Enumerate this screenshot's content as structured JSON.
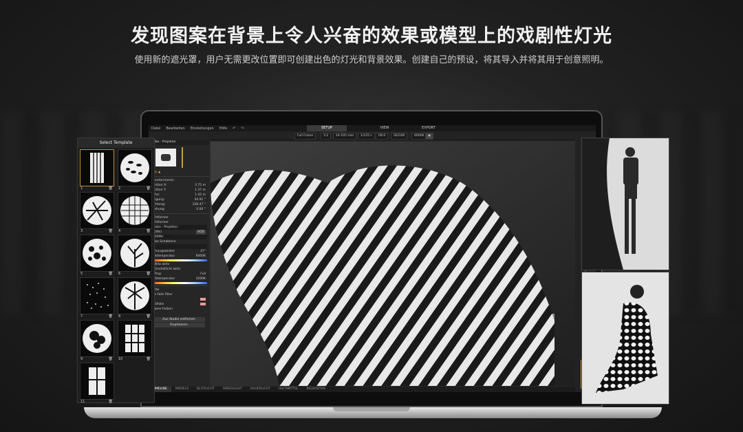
{
  "hero": {
    "title": "发现图案在背景上令人兴奋的效果或模型上的戏剧性灯光",
    "subtitle": "使用新的遮光罩，用户无需更改位置即可创建出色的灯光和背景效果。创建自己的预设，将其导入并将其用于创意照明。"
  },
  "app": {
    "menu": [
      "Datei",
      "Bearbeiten",
      "Einstellungen",
      "Hilfe"
    ],
    "tabs": [
      "SETUP",
      "VIEW",
      "EXPORT"
    ],
    "active_tab": "SETUP",
    "toolbar": [
      "Full Frame",
      "3:2",
      "24-105 mm",
      "1/125 s",
      "f/8.0",
      "ISO100",
      "6000K"
    ],
    "left_panel": {
      "header": "Frobo - Projektor",
      "section_transform": "Transformieren",
      "fields": [
        {
          "label": "Position X:",
          "value": "3.75",
          "unit": "m"
        },
        {
          "label": "Position Y:",
          "value": "1.37",
          "unit": "m"
        },
        {
          "label": "Höhe:",
          "value": "1.42",
          "unit": "m"
        },
        {
          "label": "Neigung:",
          "value": "34.91",
          "unit": "°"
        },
        {
          "label": "Richtung:",
          "value": "128.47",
          "unit": "°"
        },
        {
          "label": "Drehung:",
          "value": "0.00",
          "unit": "°"
        }
      ],
      "section_light": "Lichtformer",
      "light_item": "Lichtformer",
      "light_select": "Gobo - Projektor",
      "power": "(25Ws)",
      "add_label": "ADD",
      "ws_select": "500Ws",
      "gobo_label": "Gobo Schablone",
      "gobo_value": "1",
      "angle_label": "Öffnungswinkel",
      "angle_value": "37°",
      "temp_label": "Farbtemperatur",
      "temp_value": "6000K",
      "blitz": "Blitz aktiv",
      "einstell": "Einstelllicht aktiv",
      "prop": "Prop",
      "full": "Full",
      "temp2_label": "Farbtemperatur",
      "temp2_value": "3200K",
      "farbe": "Farbe",
      "filter": "Lee Farb Filter",
      "farbfolie": "Farbfolie",
      "eigene": "Eigene Farben",
      "btn_remove": "Aus Studio entfernen",
      "btn_dup": "Duplizieren"
    },
    "bottom_tabs": [
      "TIMELINE",
      "MODELS",
      "BLITZLICHT",
      "SPEEDLIGHT",
      "DAUERLICHT",
      "HILFSMITTEL",
      "REQUISITEN"
    ]
  },
  "template_panel": {
    "title": "Select Template",
    "items": [
      "1",
      "2",
      "3",
      "4",
      "5",
      "6",
      "7",
      "8",
      "9",
      "10",
      "11"
    ]
  }
}
